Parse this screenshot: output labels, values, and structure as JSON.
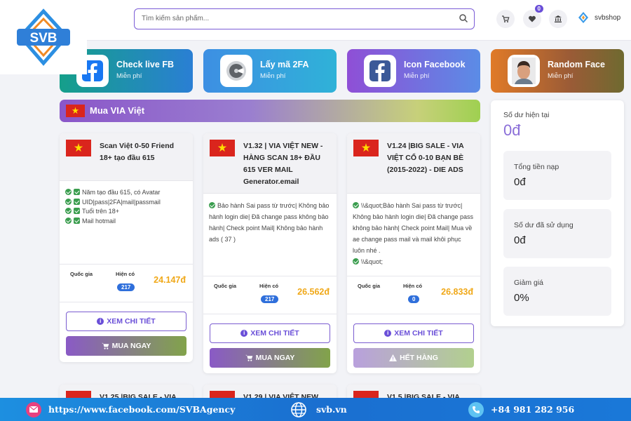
{
  "header": {
    "logo_text": "SVB",
    "search_placeholder": "Tìm kiếm sản phẩm...",
    "wishlist_count": "0",
    "username": "svbshop"
  },
  "tools": [
    {
      "title": "Check live FB",
      "subtitle": "Miễn phí",
      "icon": "facebook-icon"
    },
    {
      "title": "Lấy mã 2FA",
      "subtitle": "Miễn phí",
      "icon": "authenticator-icon"
    },
    {
      "title": "Icon Facebook",
      "subtitle": "Miễn phí",
      "icon": "facebook-icon"
    },
    {
      "title": "Random Face",
      "subtitle": "Miễn phí",
      "icon": "face-photo-icon"
    }
  ],
  "section": {
    "title": "Mua VIA Việt"
  },
  "labels": {
    "country": "Quốc gia",
    "in_stock": "Hiện có",
    "detail": "XEM CHI TIẾT",
    "buy": "MUA NGAY",
    "sold_out": "HẾT HÀNG"
  },
  "products": [
    {
      "title": "Scan Việt 0-50 Friend 18+ tạo đầu 615",
      "features": [
        "Năm tạo đầu 615, có Avatar",
        "UID|pass|2FA|mail|passmail",
        "Tuổi trên 18+",
        "Mail hotmail"
      ],
      "stock": "217",
      "price": "24.147đ",
      "action": "MUA NGAY"
    },
    {
      "title": "V1.32 | VIA VIỆT NEW - HÀNG SCAN 18+ ĐẦU 615 VER MAIL Generator.email",
      "desc": "Bảo hành Sai pass từ trước| Không bảo hành login die| Đã change pass không bảo hành| Check point Mail| Không bảo hành ads ( 37 )",
      "stock": "217",
      "price": "26.562đ",
      "action": "MUA NGAY"
    },
    {
      "title": "V1.24 |BIG SALE - VIA VIỆT CỔ 0-10 BẠN BÈ (2015-2022) - DIE ADS",
      "desc": "\\\\&quot;Bảo hành Sai pass từ trước| Không bảo hành login die| Đã change pass không bảo hành| Check point Mail| Mua về ae change pass mail và mail khôi phục luôn nhé .",
      "desc2": "\\\\&quot;",
      "stock": "0",
      "price": "26.833đ",
      "action": "HẾT HÀNG"
    }
  ],
  "next_row": [
    "V1.25 |BIG SALE - VIA",
    "V1.29 | VIA VIỆT NEW",
    "V1.5 |BIG SALE - VIA"
  ],
  "balance": {
    "label": "Số dư hiện tại",
    "value": "0đ",
    "stats": [
      {
        "label": "Tổng tiền nạp",
        "value": "0đ"
      },
      {
        "label": "Số dư đã sử dụng",
        "value": "0đ"
      },
      {
        "label": "Giảm giá",
        "value": "0%"
      }
    ]
  },
  "footer": {
    "facebook": "https://www.facebook.com/SVBAgency",
    "website": "svb.vn",
    "phone": "+84 981 282 956"
  },
  "colors": {
    "accent": "#6a4fd8",
    "price": "#f0a818",
    "badge": "#2f6fdb",
    "footer": "#1a6fd0"
  }
}
